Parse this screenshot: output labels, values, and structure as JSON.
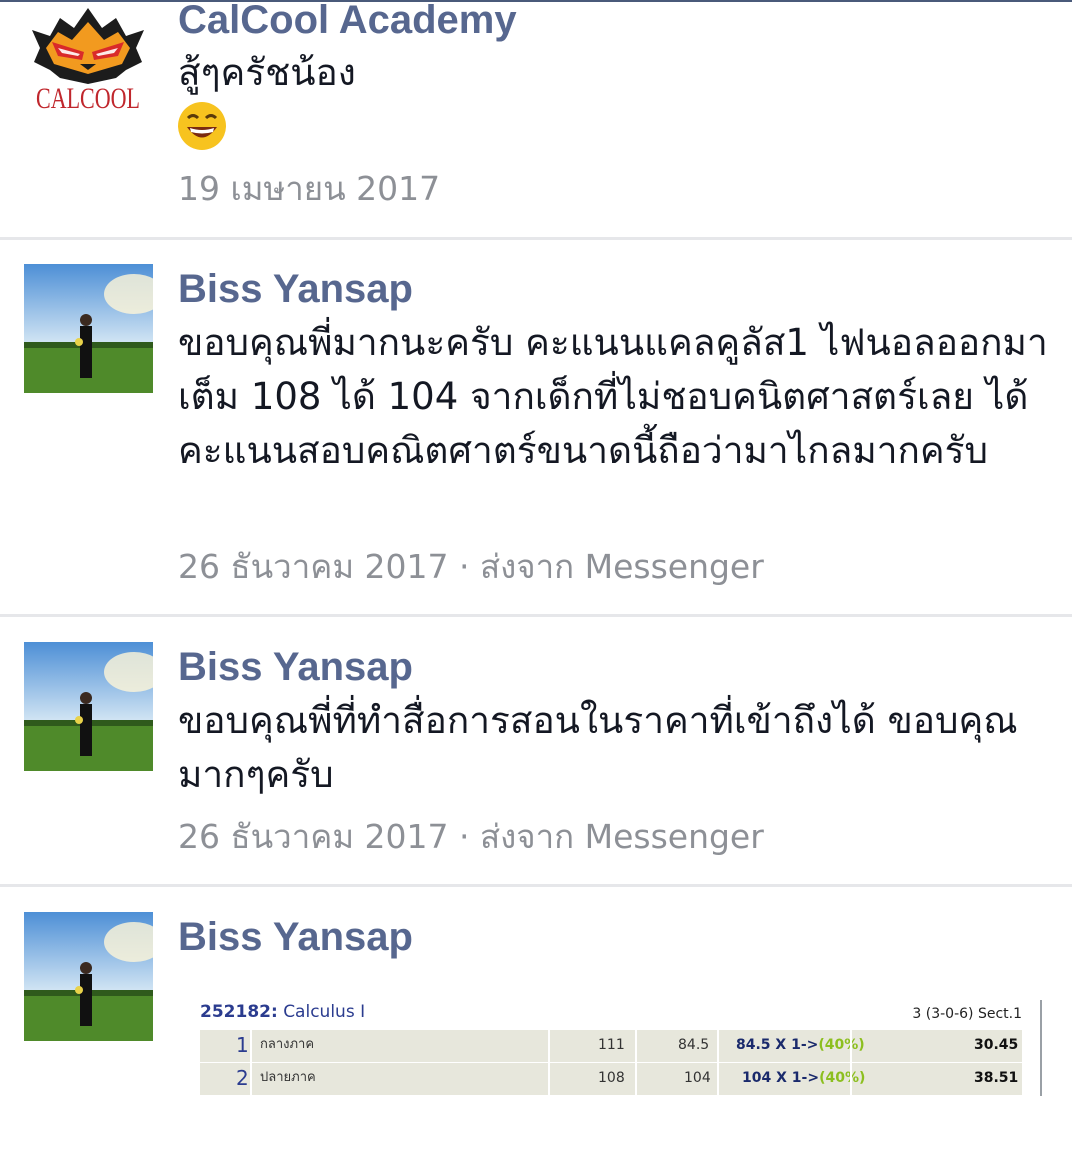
{
  "posts": [
    {
      "name": "CalCool Academy",
      "logo_text": "CALCOOL",
      "message": "สู้ๆครัชน้อง",
      "emoji": "😄",
      "meta": "19 เมษายน 2017"
    },
    {
      "name": "Biss Yansap",
      "message": "ขอบคุณพี่มากนะครับ คะแนนแคลคูลัส1 ไฟนอลออกมา เต็ม 108 ได้ 104 จากเด็กที่ไม่ชอบคนิตศาสตร์เลย ได้คะแนนสอบคณิตศาตร์ขนาดนี้ถือว่ามาไกลมากครับ",
      "meta": "26 ธันวาคม 2017 · ส่งจาก Messenger"
    },
    {
      "name": "Biss Yansap",
      "message": "ขอบคุณพี่ที่ทำสื่อการสอนในราคาที่เข้าถึงได้ ขอบคุณมากๆครับ",
      "meta": "26 ธันวาคม 2017 · ส่งจาก Messenger"
    },
    {
      "name": "Biss Yansap"
    }
  ],
  "grade_card": {
    "course_code": "252182:",
    "course_name": "Calculus I",
    "credit_info": "3 (3-0-6)  Sect.1",
    "rows": [
      {
        "no": "1",
        "exam": "กลางภาค",
        "full": "111",
        "score": "84.5",
        "calc": "84.5 X 1->",
        "pct": "(40%)",
        "weighted": "30.45"
      },
      {
        "no": "2",
        "exam": "ปลายภาค",
        "full": "108",
        "score": "104",
        "calc": "104 X 1->",
        "pct": "(40%)",
        "weighted": "38.51"
      }
    ]
  },
  "colors": {
    "name": "#57678f",
    "message": "#141823",
    "meta": "#8d9096",
    "divider": "#e6e7ea",
    "logo_red": "#c0272d"
  }
}
